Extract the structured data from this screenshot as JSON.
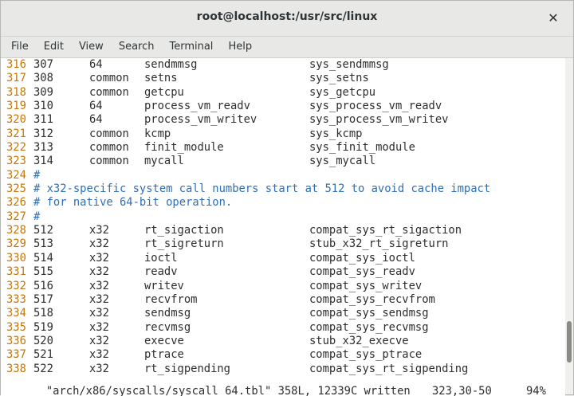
{
  "window": {
    "title": "root@localhost:/usr/src/linux",
    "close_glyph": "✕"
  },
  "menu": [
    "File",
    "Edit",
    "View",
    "Search",
    "Terminal",
    "Help"
  ],
  "lines": [
    {
      "ln": "316",
      "kind": "row",
      "cols": [
        "307",
        "64",
        "sendmmsg",
        "sys_sendmmsg"
      ]
    },
    {
      "ln": "317",
      "kind": "row",
      "cols": [
        "308",
        "common",
        "setns",
        "sys_setns"
      ]
    },
    {
      "ln": "318",
      "kind": "row",
      "cols": [
        "309",
        "common",
        "getcpu",
        "sys_getcpu"
      ]
    },
    {
      "ln": "319",
      "kind": "row",
      "cols": [
        "310",
        "64",
        "process_vm_readv",
        "sys_process_vm_readv"
      ]
    },
    {
      "ln": "320",
      "kind": "row",
      "cols": [
        "311",
        "64",
        "process_vm_writev",
        "sys_process_vm_writev"
      ]
    },
    {
      "ln": "321",
      "kind": "row",
      "cols": [
        "312",
        "common",
        "kcmp",
        "sys_kcmp"
      ]
    },
    {
      "ln": "322",
      "kind": "row",
      "cols": [
        "313",
        "common",
        "finit_module",
        "sys_finit_module"
      ]
    },
    {
      "ln": "323",
      "kind": "row",
      "cols": [
        "314",
        "common",
        "mycall",
        "sys_mycall"
      ]
    },
    {
      "ln": "324",
      "kind": "comment",
      "text": "#"
    },
    {
      "ln": "325",
      "kind": "comment",
      "text": "# x32-specific system call numbers start at 512 to avoid cache impact"
    },
    {
      "ln": "326",
      "kind": "comment",
      "text": "# for native 64-bit operation."
    },
    {
      "ln": "327",
      "kind": "comment",
      "text": "#"
    },
    {
      "ln": "328",
      "kind": "row",
      "cols": [
        "512",
        "x32",
        "rt_sigaction",
        "compat_sys_rt_sigaction"
      ]
    },
    {
      "ln": "329",
      "kind": "row",
      "cols": [
        "513",
        "x32",
        "rt_sigreturn",
        "stub_x32_rt_sigreturn"
      ]
    },
    {
      "ln": "330",
      "kind": "row",
      "cols": [
        "514",
        "x32",
        "ioctl",
        "compat_sys_ioctl"
      ]
    },
    {
      "ln": "331",
      "kind": "row",
      "cols": [
        "515",
        "x32",
        "readv",
        "compat_sys_readv"
      ]
    },
    {
      "ln": "332",
      "kind": "row",
      "cols": [
        "516",
        "x32",
        "writev",
        "compat_sys_writev"
      ]
    },
    {
      "ln": "333",
      "kind": "row",
      "cols": [
        "517",
        "x32",
        "recvfrom",
        "compat_sys_recvfrom"
      ]
    },
    {
      "ln": "334",
      "kind": "row",
      "cols": [
        "518",
        "x32",
        "sendmsg",
        "compat_sys_sendmsg"
      ]
    },
    {
      "ln": "335",
      "kind": "row",
      "cols": [
        "519",
        "x32",
        "recvmsg",
        "compat_sys_recvmsg"
      ]
    },
    {
      "ln": "336",
      "kind": "row",
      "cols": [
        "520",
        "x32",
        "execve",
        "stub_x32_execve"
      ]
    },
    {
      "ln": "337",
      "kind": "row",
      "cols": [
        "521",
        "x32",
        "ptrace",
        "compat_sys_ptrace"
      ]
    },
    {
      "ln": "338",
      "kind": "row",
      "cols": [
        "522",
        "x32",
        "rt_sigpending",
        "compat_sys_rt_sigpending"
      ]
    }
  ],
  "status": {
    "message": "\"arch/x86/syscalls/syscall_64.tbl\" 358L, 12339C written",
    "position": "323,30-50",
    "percent": "94%"
  },
  "colors": {
    "line_number": "#c4770e",
    "comment": "#2f6fb5",
    "text": "#2e2e2e"
  }
}
